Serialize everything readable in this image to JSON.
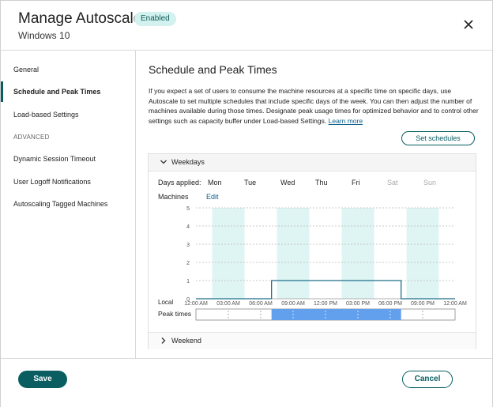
{
  "header": {
    "title": "Manage Autoscale",
    "badge": "Enabled",
    "subtitle": "Windows 10",
    "close_icon": "close-icon"
  },
  "sidebar": {
    "items": [
      {
        "label": "General",
        "active": false
      },
      {
        "label": "Schedule and Peak Times",
        "active": true
      },
      {
        "label": "Load-based Settings",
        "active": false
      }
    ],
    "section_label": "ADVANCED",
    "advanced_items": [
      {
        "label": "Dynamic Session Timeout"
      },
      {
        "label": "User Logoff Notifications"
      },
      {
        "label": "Autoscaling Tagged Machines"
      }
    ]
  },
  "main": {
    "title": "Schedule and Peak Times",
    "description": "If you expect a set of users to consume the machine resources at a specific time on specific days, use Autoscale to set multiple schedules that include specific days of the week. You can then adjust the number of machines available during those times. Designate peak usage times for optimized behavior and to control other settings such as capacity buffer under Load-based Settings.",
    "learn_more": "Learn more",
    "set_schedules_label": "Set schedules",
    "schedule": {
      "name": "Weekdays",
      "days_applied_label": "Days applied:",
      "days": [
        {
          "label": "Mon",
          "applied": true
        },
        {
          "label": "Tue",
          "applied": true
        },
        {
          "label": "Wed",
          "applied": true
        },
        {
          "label": "Thu",
          "applied": true
        },
        {
          "label": "Fri",
          "applied": true
        },
        {
          "label": "Sat",
          "applied": false
        },
        {
          "label": "Sun",
          "applied": false
        }
      ],
      "machines_label": "Machines",
      "edit_label": "Edit",
      "local_label": "Local",
      "peak_times_label": "Peak times"
    },
    "second_schedule": {
      "name": "Weekend"
    }
  },
  "chart_data": {
    "type": "line",
    "ylabel": "Machines",
    "xlabel": "Local",
    "ylim": [
      0,
      5
    ],
    "yticks": [
      0,
      1,
      2,
      3,
      4,
      5
    ],
    "xticks": [
      "12:00 AM",
      "03:00 AM",
      "06:00 AM",
      "09:00 AM",
      "12:00 PM",
      "03:00 PM",
      "06:00 PM",
      "09:00 PM",
      "12:00 AM"
    ],
    "series": [
      {
        "x_hours": [
          0,
          7,
          7,
          19,
          19,
          24
        ],
        "values": [
          0,
          0,
          1,
          1,
          0,
          0
        ]
      }
    ],
    "peak_times": {
      "start_hour": 7,
      "end_hour": 19
    },
    "shaded_columns_hours": [
      [
        1.5,
        4.5
      ],
      [
        7.5,
        10.5
      ],
      [
        13.5,
        16.5
      ],
      [
        19.5,
        22.5
      ]
    ],
    "colors": {
      "shade": "#dff5f3",
      "line": "#1f6d8a",
      "peak": "#62a0ee",
      "grid": "#bbbbbb"
    }
  },
  "footer": {
    "save_label": "Save",
    "cancel_label": "Cancel"
  }
}
